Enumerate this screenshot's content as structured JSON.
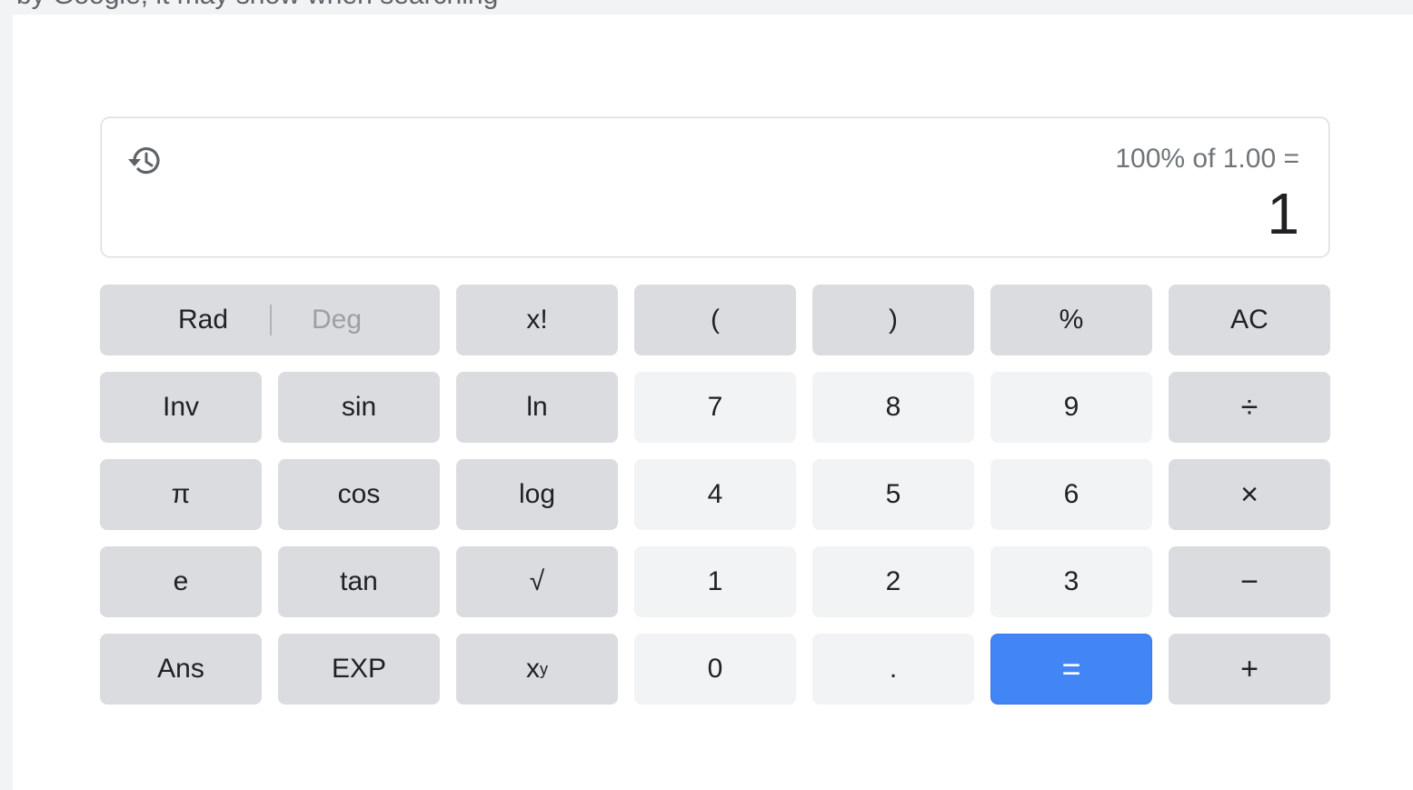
{
  "top_text": "by Google, it may show when searching",
  "display": {
    "expression": "100% of 1.00 =",
    "result": "1"
  },
  "keys": {
    "rad": "Rad",
    "deg": "Deg",
    "fact": "x!",
    "lparen": "(",
    "rparen": ")",
    "percent": "%",
    "ac": "AC",
    "inv": "Inv",
    "sin": "sin",
    "ln": "ln",
    "d7": "7",
    "d8": "8",
    "d9": "9",
    "divide": "÷",
    "pi": "π",
    "cos": "cos",
    "log": "log",
    "d4": "4",
    "d5": "5",
    "d6": "6",
    "multiply": "×",
    "e": "e",
    "tan": "tan",
    "sqrt": "√",
    "d1": "1",
    "d2": "2",
    "d3": "3",
    "minus": "−",
    "ans": "Ans",
    "exp": "EXP",
    "pow_base": "x",
    "pow_exp": "y",
    "d0": "0",
    "dot": ".",
    "equals": "=",
    "plus": "+"
  },
  "colors": {
    "equals_blue": "#4285f4",
    "function_key": "#dadce0",
    "number_key": "#f1f3f4"
  }
}
